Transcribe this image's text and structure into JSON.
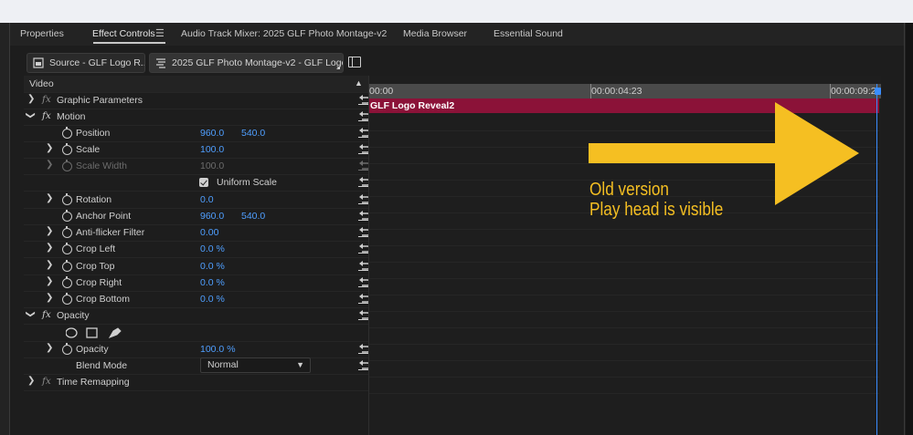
{
  "tabs": [
    {
      "label": "Properties"
    },
    {
      "label": "Effect Controls"
    },
    {
      "label": "Audio Track Mixer: 2025 GLF Photo Montage-v2"
    },
    {
      "label": "Media Browser"
    },
    {
      "label": "Essential Sound"
    }
  ],
  "source": {
    "source_label": "Source - GLF Logo R...",
    "sequence_label": "2025 GLF Photo Montage-v2 - GLF Logo..."
  },
  "section_video": "Video",
  "props": {
    "graphic_parameters": "Graphic Parameters",
    "motion": "Motion",
    "position": {
      "label": "Position",
      "x": "960.0",
      "y": "540.0"
    },
    "scale": {
      "label": "Scale",
      "value": "100.0"
    },
    "scale_width": {
      "label": "Scale Width",
      "value": "100.0"
    },
    "uniform_scale": {
      "label": "Uniform Scale",
      "checked": true
    },
    "rotation": {
      "label": "Rotation",
      "value": "0.0"
    },
    "anchor_point": {
      "label": "Anchor Point",
      "x": "960.0",
      "y": "540.0"
    },
    "anti_flicker": {
      "label": "Anti-flicker Filter",
      "value": "0.00"
    },
    "crop_left": {
      "label": "Crop Left",
      "value": "0.0 %"
    },
    "crop_top": {
      "label": "Crop Top",
      "value": "0.0 %"
    },
    "crop_right": {
      "label": "Crop Right",
      "value": "0.0 %"
    },
    "crop_bottom": {
      "label": "Crop Bottom",
      "value": "0.0 %"
    },
    "opacity_group": "Opacity",
    "opacity": {
      "label": "Opacity",
      "value": "100.0 %"
    },
    "blend_mode": {
      "label": "Blend Mode",
      "value": "Normal"
    },
    "time_remapping": "Time Remapping"
  },
  "timeline": {
    "tc_start": "00:00",
    "tc_mid": "00:00:04:23",
    "tc_end": "00:00:09:23",
    "clip_name": "GLF Logo Reveal2"
  },
  "annotation": {
    "line1": "Old version",
    "line2": "Play head is visible",
    "color": "#f5bf22"
  },
  "colors": {
    "accent_blue": "#4f9fff",
    "clip": "#8b1238",
    "playhead": "#3a8dff"
  }
}
